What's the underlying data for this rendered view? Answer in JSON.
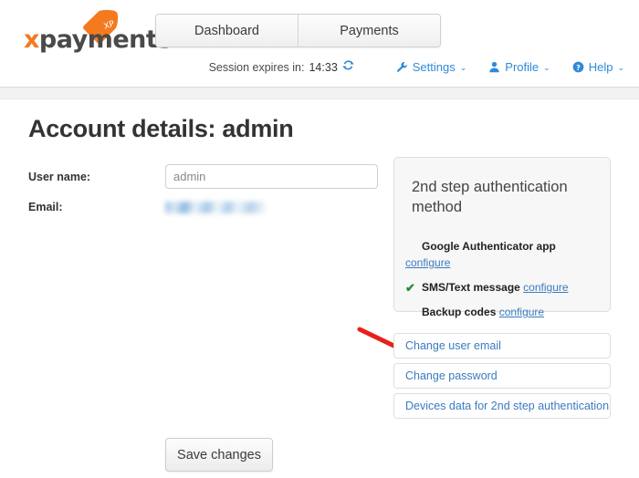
{
  "brand": {
    "logo_x": "x",
    "logo_rest": "payments",
    "tag_label": "XP",
    "accent_color": "#f47a20"
  },
  "nav": {
    "tabs": [
      {
        "label": "Dashboard"
      },
      {
        "label": "Payments"
      }
    ]
  },
  "utilbar": {
    "session_label": "Session expires in:",
    "session_time": "14:33",
    "refresh_icon": "refresh-icon",
    "items": [
      {
        "label": "Settings",
        "icon": "wrench-icon"
      },
      {
        "label": "Profile",
        "icon": "user-icon"
      },
      {
        "label": "Help",
        "icon": "question-circle-icon"
      }
    ],
    "caret": "⌄"
  },
  "page": {
    "title": "Account details: admin"
  },
  "form": {
    "username_label": "User name:",
    "username_value": "admin",
    "username_placeholder": "",
    "email_label": "Email:",
    "email_value": "",
    "save_label": "Save changes"
  },
  "auth_panel": {
    "title": "2nd step authentication method",
    "methods": [
      {
        "name": "Google Authenticator app",
        "link": "configure",
        "enabled": false,
        "wrapped": true
      },
      {
        "name": "SMS/Text message",
        "link": "configure",
        "enabled": true,
        "wrapped": false
      },
      {
        "name": "Backup codes",
        "link": "configure",
        "enabled": false,
        "wrapped": false
      }
    ],
    "check_glyph": "✔",
    "link_color": "#3b7bbf",
    "check_color": "#1d8f3a"
  },
  "actions": [
    {
      "label": "Change user email"
    },
    {
      "label": "Change password"
    },
    {
      "label": "Devices data for 2nd step authentication"
    }
  ],
  "annotation": {
    "arrow_color": "#e8201a",
    "points_to": "configure"
  }
}
